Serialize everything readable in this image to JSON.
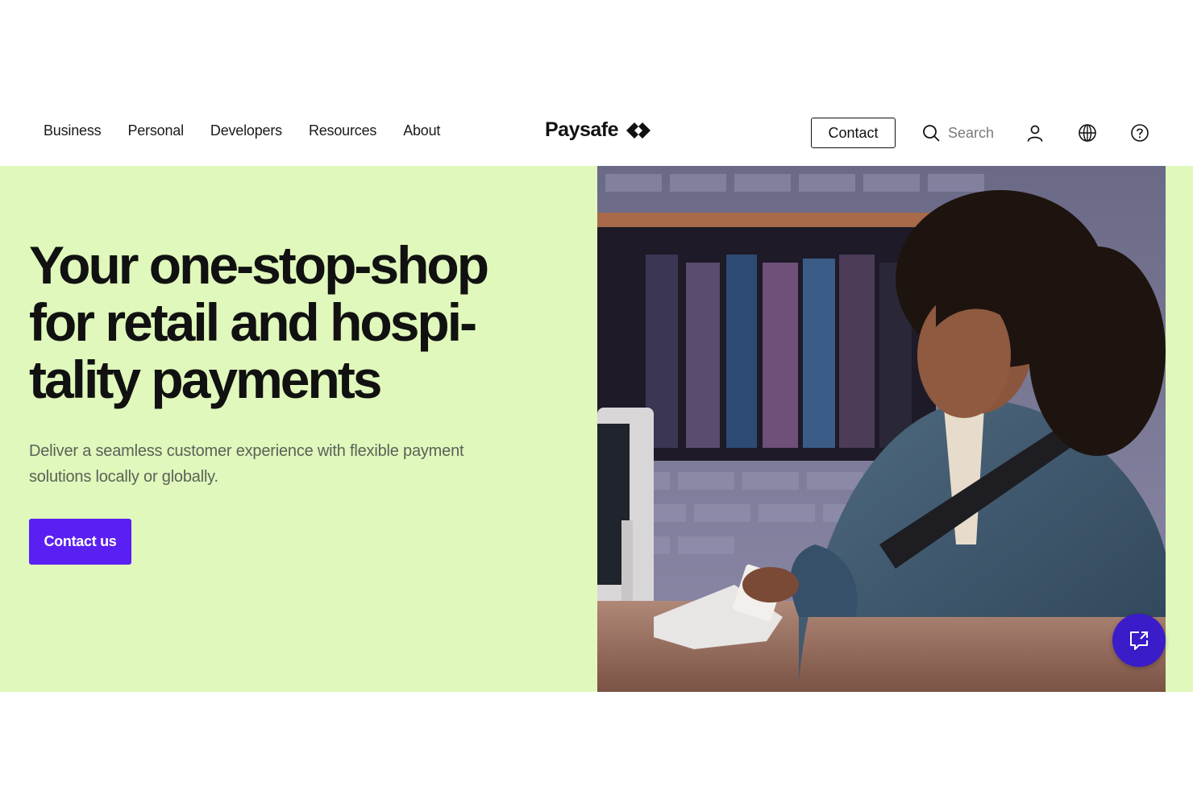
{
  "nav": {
    "items": [
      {
        "label": "Business"
      },
      {
        "label": "Personal"
      },
      {
        "label": "Developers"
      },
      {
        "label": "Resources"
      },
      {
        "label": "About"
      }
    ],
    "logo_text": "Paysafe",
    "contact_label": "Contact",
    "search_label": "Search"
  },
  "hero": {
    "title_lines": [
      "Your one-stop-shop",
      "for retail and hospi-",
      "tality payments"
    ],
    "subtitle_lines": [
      "Deliver a seamless customer experience with flexible payment",
      "solutions locally or globally."
    ],
    "cta_label": "Contact us",
    "background_color": "#e0f8bb",
    "cta_color": "#5a1ff2"
  },
  "icons": {
    "logo": "paysafe-diamond-arrow-icon",
    "search": "search-icon",
    "account": "user-icon",
    "language": "globe-icon",
    "help": "help-icon",
    "chat": "chat-bubble-icon"
  }
}
